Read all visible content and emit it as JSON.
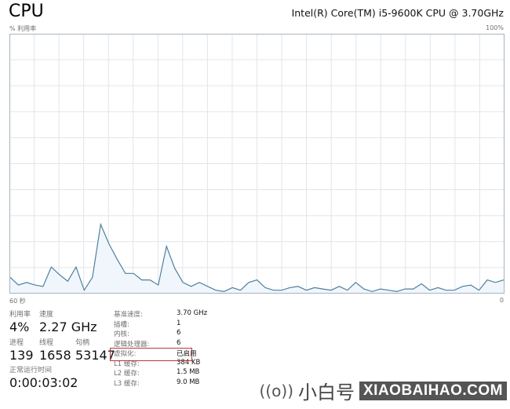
{
  "header": {
    "title": "CPU",
    "cpu_model": "Intel(R) Core(TM) i5-9600K CPU @ 3.70GHz"
  },
  "graph": {
    "y_label": "% 利用率",
    "y_max_label": "100%",
    "x_label": "60 秒",
    "x_min_label": "0",
    "colors": {
      "line": "#4f7fa0",
      "fill": "#f0f6fb",
      "grid": "#e1e5ea",
      "border": "#a8b4bf"
    }
  },
  "chart_data": {
    "type": "area",
    "title": "% 利用率",
    "xlabel": "60 秒",
    "ylabel": "% 利用率",
    "xlim": [
      60,
      0
    ],
    "ylim": [
      0,
      100
    ],
    "grid": true,
    "x": [
      60,
      59,
      58,
      57,
      56,
      55,
      54,
      53,
      52,
      51,
      50,
      49,
      48,
      47,
      46,
      45,
      44,
      43,
      42,
      41,
      40,
      39,
      38,
      37,
      36,
      35,
      34,
      33,
      32,
      31,
      30,
      29,
      28,
      27,
      26,
      25,
      24,
      23,
      22,
      21,
      20,
      19,
      18,
      17,
      16,
      15,
      14,
      13,
      12,
      11,
      10,
      9,
      8,
      7,
      6,
      5,
      4,
      3,
      2,
      1,
      0
    ],
    "values": [
      6,
      3,
      4,
      3,
      2.5,
      10,
      7,
      4.5,
      10,
      1,
      6,
      26.5,
      19,
      13,
      7.5,
      7.5,
      5,
      5,
      3,
      18,
      9.5,
      4,
      2.5,
      4,
      2.5,
      1,
      0.5,
      2,
      1,
      4,
      5,
      2,
      1,
      1,
      2,
      2.5,
      1,
      2,
      1.5,
      1,
      2.5,
      1,
      4,
      1.5,
      0.5,
      1.5,
      1,
      0.5,
      1.5,
      1.5,
      3.5,
      1,
      2,
      1,
      1,
      2.5,
      3,
      1,
      5,
      4,
      5
    ]
  },
  "stats": {
    "utilization": {
      "label": "利用率",
      "value": "4%"
    },
    "speed": {
      "label": "速度",
      "value": "2.27 GHz"
    },
    "processes": {
      "label": "进程",
      "value": "139"
    },
    "threads": {
      "label": "线程",
      "value": "1658"
    },
    "handles": {
      "label": "句柄",
      "value": "53147"
    },
    "uptime": {
      "label": "正常运行时间",
      "value": "0:00:03:02"
    }
  },
  "details": [
    {
      "key": "基准速度:",
      "value": "3.70 GHz"
    },
    {
      "key": "插槽:",
      "value": "1"
    },
    {
      "key": "内核:",
      "value": "6"
    },
    {
      "key": "逻辑处理器:",
      "value": "6"
    },
    {
      "key": "虚拟化:",
      "value": "已启用"
    },
    {
      "key": "L1 缓存:",
      "value": "384 KB"
    },
    {
      "key": "L2 缓存:",
      "value": "1.5 MB"
    },
    {
      "key": "L3 缓存:",
      "value": "9.0 MB"
    }
  ],
  "watermark": {
    "icon": "broadcast-icon",
    "icon_glyph": "((o))",
    "brand": "小白号",
    "site": "XIAOBAIHAO.COM"
  }
}
